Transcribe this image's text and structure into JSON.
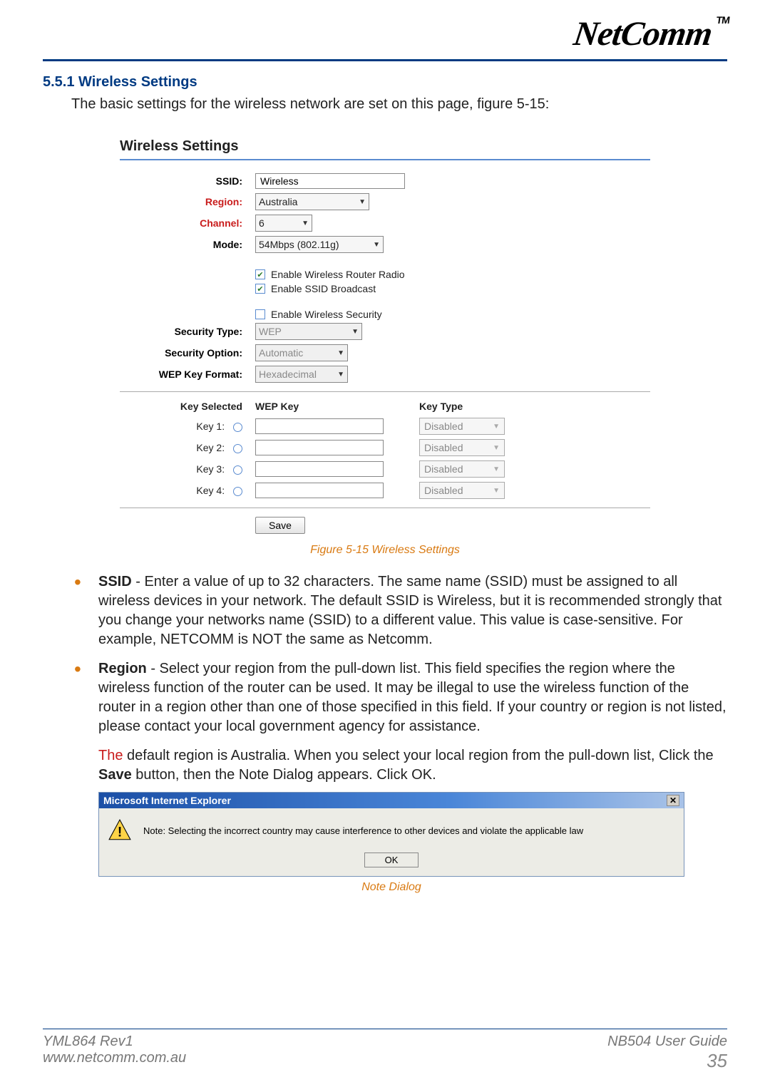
{
  "brand": {
    "name": "NetComm",
    "tm": "TM"
  },
  "section": {
    "number": "5.5.1",
    "title": "Wireless Settings"
  },
  "intro": "The basic settings for the wireless network are set on this page, figure 5-15:",
  "panel": {
    "title": "Wireless Settings",
    "ssid_label": "SSID:",
    "ssid_value": "Wireless",
    "region_label": "Region:",
    "region_value": "Australia",
    "channel_label": "Channel:",
    "channel_value": "6",
    "mode_label": "Mode:",
    "mode_value": "54Mbps (802.11g)",
    "cb_router": "Enable Wireless Router Radio",
    "cb_ssid": "Enable SSID Broadcast",
    "cb_security": "Enable Wireless Security",
    "security_type_label": "Security Type:",
    "security_type_value": "WEP",
    "security_option_label": "Security Option:",
    "security_option_value": "Automatic",
    "wep_format_label": "WEP Key Format:",
    "wep_format_value": "Hexadecimal",
    "wep_header": {
      "col1": "Key Selected",
      "col2": "WEP Key",
      "col3": "Key Type"
    },
    "keys": [
      {
        "label": "Key 1:",
        "type": "Disabled"
      },
      {
        "label": "Key 2:",
        "type": "Disabled"
      },
      {
        "label": "Key 3:",
        "type": "Disabled"
      },
      {
        "label": "Key 4:",
        "type": "Disabled"
      }
    ],
    "save": "Save"
  },
  "figure_caption": "Figure 5-15 Wireless Settings",
  "bullets": {
    "ssid": {
      "head": "SSID",
      "text": " - Enter a value of up to 32 characters. The same name (SSID) must be assigned to all wireless devices in your network. The default SSID is Wireless, but it is recommended strongly that you change your networks name (SSID) to a different value. This value is case-sensitive. For example, NETCOMM is NOT the same as Netcomm."
    },
    "region": {
      "head": "Region",
      "text": " - Select your region from the pull-down list. This field specifies the region where the wireless function of the router can be used. It may be illegal to use the wireless function of the router in a region other than one of those specified in this field. If your country or region is not listed, please contact your local government agency for assistance."
    }
  },
  "note": {
    "the": "The",
    "rest_a": " default region is Australia. When you select your local region from the pull-down list, Click the ",
    "save_bold": "Save",
    "rest_b": " button, then the Note Dialog appears. Click OK."
  },
  "dialog": {
    "title": "Microsoft Internet Explorer",
    "body": "Note: Selecting the incorrect country may cause interference to other devices and violate the applicable law",
    "ok": "OK"
  },
  "dialog_caption": "Note Dialog",
  "footer": {
    "rev": "YML864 Rev1",
    "url": "www.netcomm.com.au",
    "guide": "NB504 User Guide",
    "page": "35"
  }
}
